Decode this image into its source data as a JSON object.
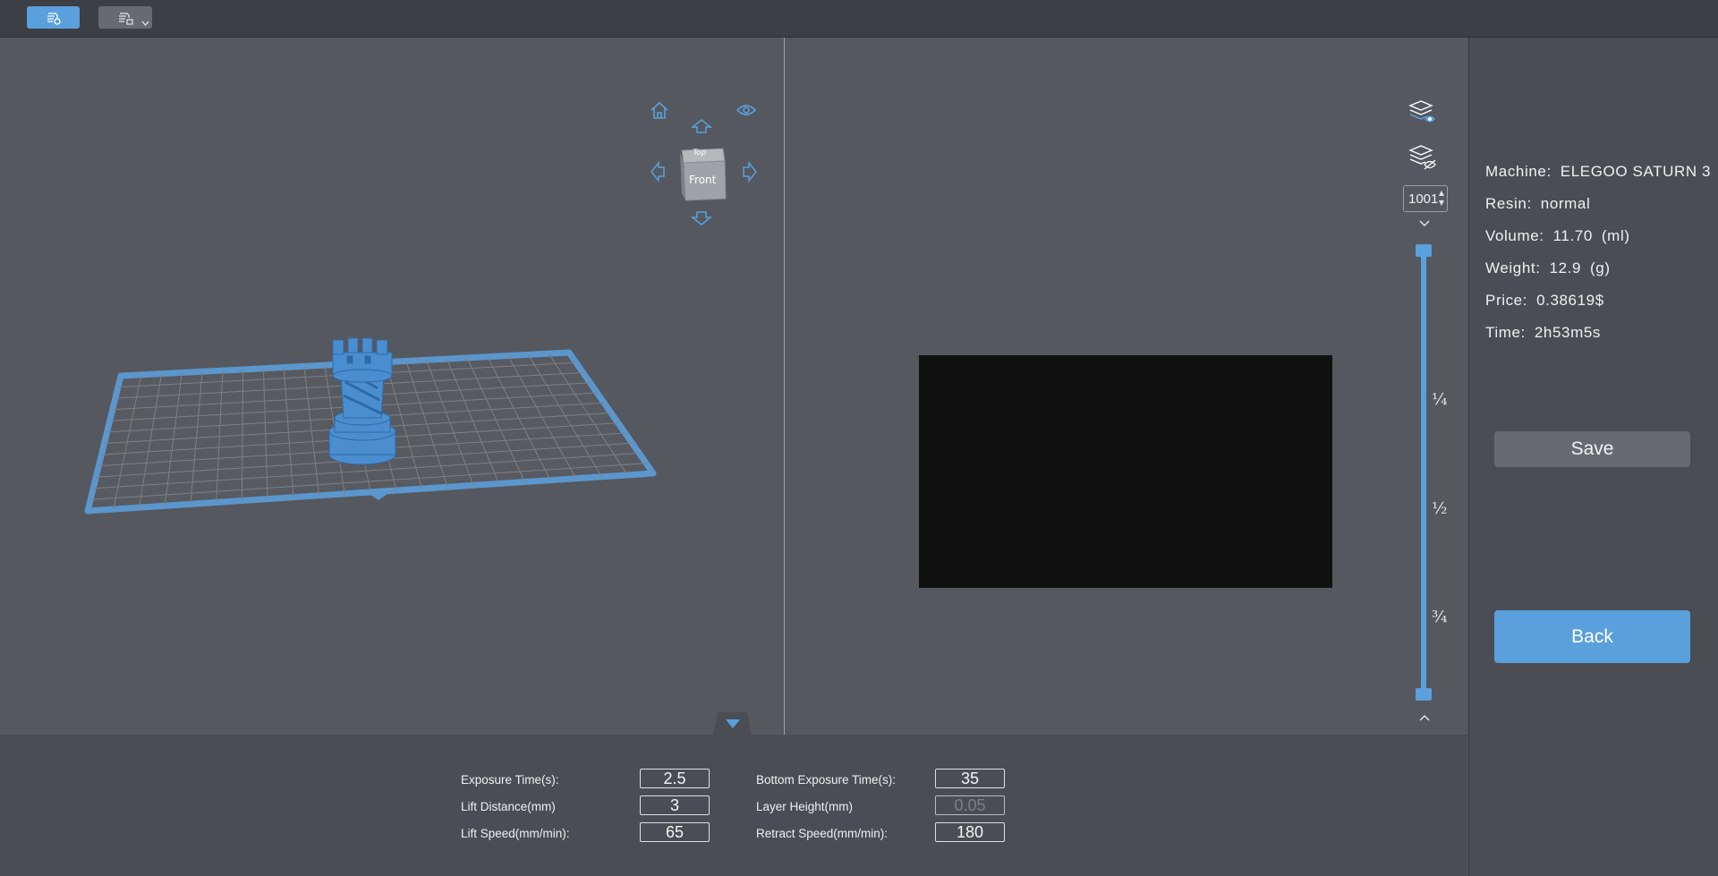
{
  "toolbar": {
    "items": [
      {
        "name": "slice-view-icon",
        "active": true
      },
      {
        "name": "print-settings-icon",
        "active": false,
        "has_dropdown": true
      }
    ]
  },
  "navcube": {
    "top_face": "Top",
    "front_face": "Front",
    "icons": [
      "home-icon",
      "eye-icon",
      "arrow-up-icon",
      "arrow-left-icon",
      "arrow-right-icon",
      "arrow-down-icon"
    ]
  },
  "layer_slider": {
    "current_layer": "1001",
    "marks": [
      "¼",
      "½",
      "¾"
    ],
    "top_fraction": 1.0,
    "bottom_fraction": 0.0
  },
  "info": {
    "machine": {
      "label": "Machine:",
      "value": "ELEGOO SATURN 3"
    },
    "resin": {
      "label": "Resin:",
      "value": "normal"
    },
    "volume": {
      "label": "Volume:",
      "value": "11.70",
      "unit": "(ml)"
    },
    "weight": {
      "label": "Weight:",
      "value": "12.9",
      "unit": "(g)"
    },
    "price": {
      "label": "Price:",
      "value": "0.38619$"
    },
    "time": {
      "label": "Time:",
      "value": "2h53m5s"
    }
  },
  "buttons": {
    "save": "Save",
    "back": "Back"
  },
  "params": {
    "exposure_time": {
      "label": "Exposure Time(s):",
      "value": "2.5"
    },
    "lift_distance": {
      "label": "Lift Distance(mm)",
      "value": "3"
    },
    "lift_speed": {
      "label": "Lift Speed(mm/min):",
      "value": "65"
    },
    "bottom_exposure_time": {
      "label": "Bottom Exposure Time(s):",
      "value": "35"
    },
    "layer_height": {
      "label": "Layer Height(mm)",
      "value": "0.05",
      "disabled": true
    },
    "retract_speed": {
      "label": "Retract Speed(mm/min):",
      "value": "180"
    }
  },
  "colors": {
    "accent": "#5aa0dc",
    "background": "#50535a",
    "panel": "#4a4d53",
    "preview": "#111111"
  }
}
